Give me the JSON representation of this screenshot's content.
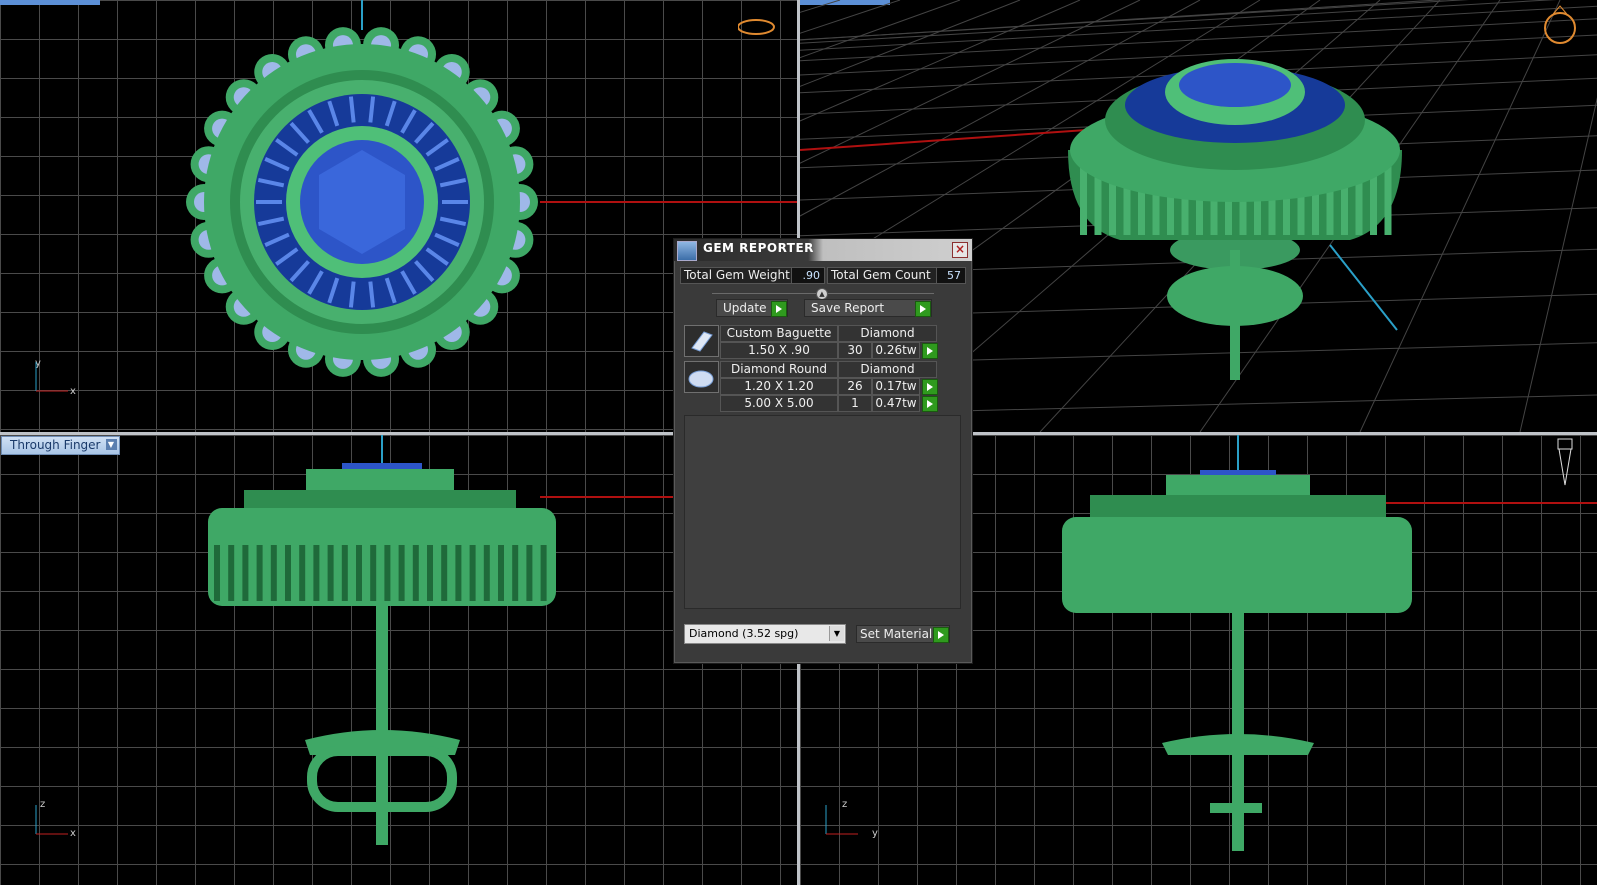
{
  "viewports": {
    "top_left": {
      "label": "",
      "axes": [
        "y",
        "x"
      ]
    },
    "top_right": {
      "label": ""
    },
    "bottom_left": {
      "label": "Through Finger",
      "axes": [
        "z",
        "x"
      ]
    },
    "bottom_right": {
      "axes": [
        "z",
        "y"
      ]
    }
  },
  "dialog": {
    "title": "GEM REPORTER",
    "close_symbol": "×",
    "total_weight_label": "Total Gem Weight",
    "total_weight_value": ".90",
    "total_count_label": "Total Gem Count",
    "total_count_value": "57",
    "update_label": "Update",
    "save_report_label": "Save Report",
    "gems": [
      {
        "icon": "baguette-gem-icon",
        "name": "Custom Baguette",
        "material": "Diamond",
        "rows": [
          {
            "size": "1.50 X .90",
            "count": "30",
            "weight": "0.26tw"
          }
        ]
      },
      {
        "icon": "round-gem-icon",
        "name": "Diamond Round",
        "material": "Diamond",
        "rows": [
          {
            "size": "1.20 X 1.20",
            "count": "26",
            "weight": "0.17tw"
          },
          {
            "size": "5.00 X 5.00",
            "count": "1",
            "weight": "0.47tw"
          }
        ]
      }
    ],
    "material_select": "Diamond    (3.52 spg)",
    "set_material_label": "Set Material"
  },
  "colors": {
    "metal": "#3fa866",
    "gem": "#2d55c8",
    "grid": "#4a4a4a",
    "panel": "#3a3a3a"
  }
}
